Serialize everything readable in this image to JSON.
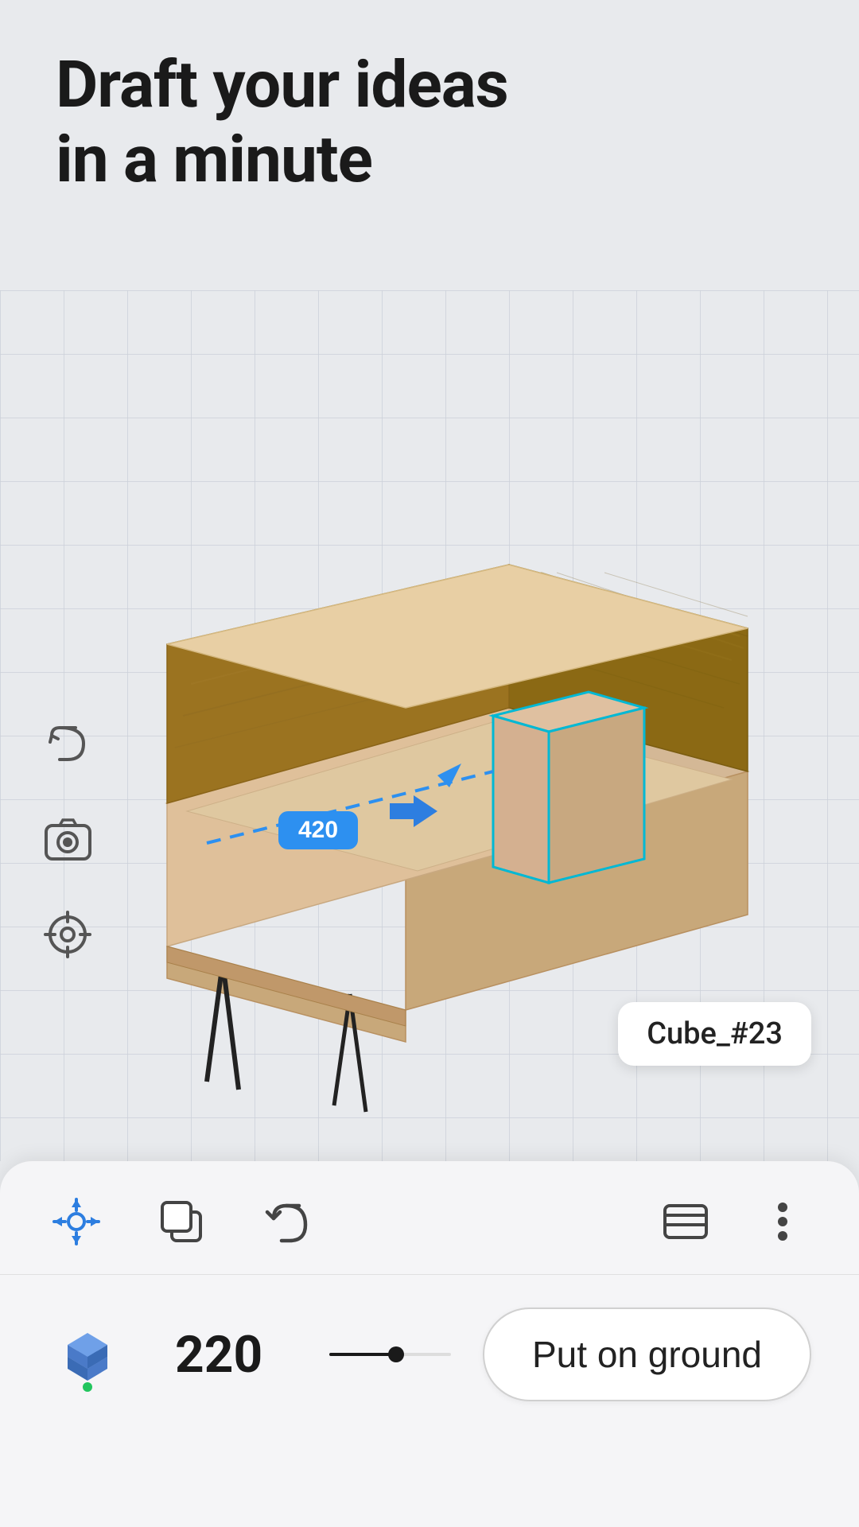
{
  "header": {
    "title_line1": "Draft your ideas",
    "title_line2": "in a minute"
  },
  "viewport": {
    "object_label": "Cube_#23",
    "measurement": "420",
    "height_value": "220"
  },
  "toolbar": {
    "move_icon": "⊹",
    "copy_icon": "❑",
    "undo_icon": "↩",
    "paint_icon": "⊓",
    "more_icon": "⋮",
    "undo_left_icon": "↺",
    "screenshot_icon": "⊙",
    "target_icon": "◎"
  },
  "actions": {
    "put_on_ground": "Put on ground"
  }
}
